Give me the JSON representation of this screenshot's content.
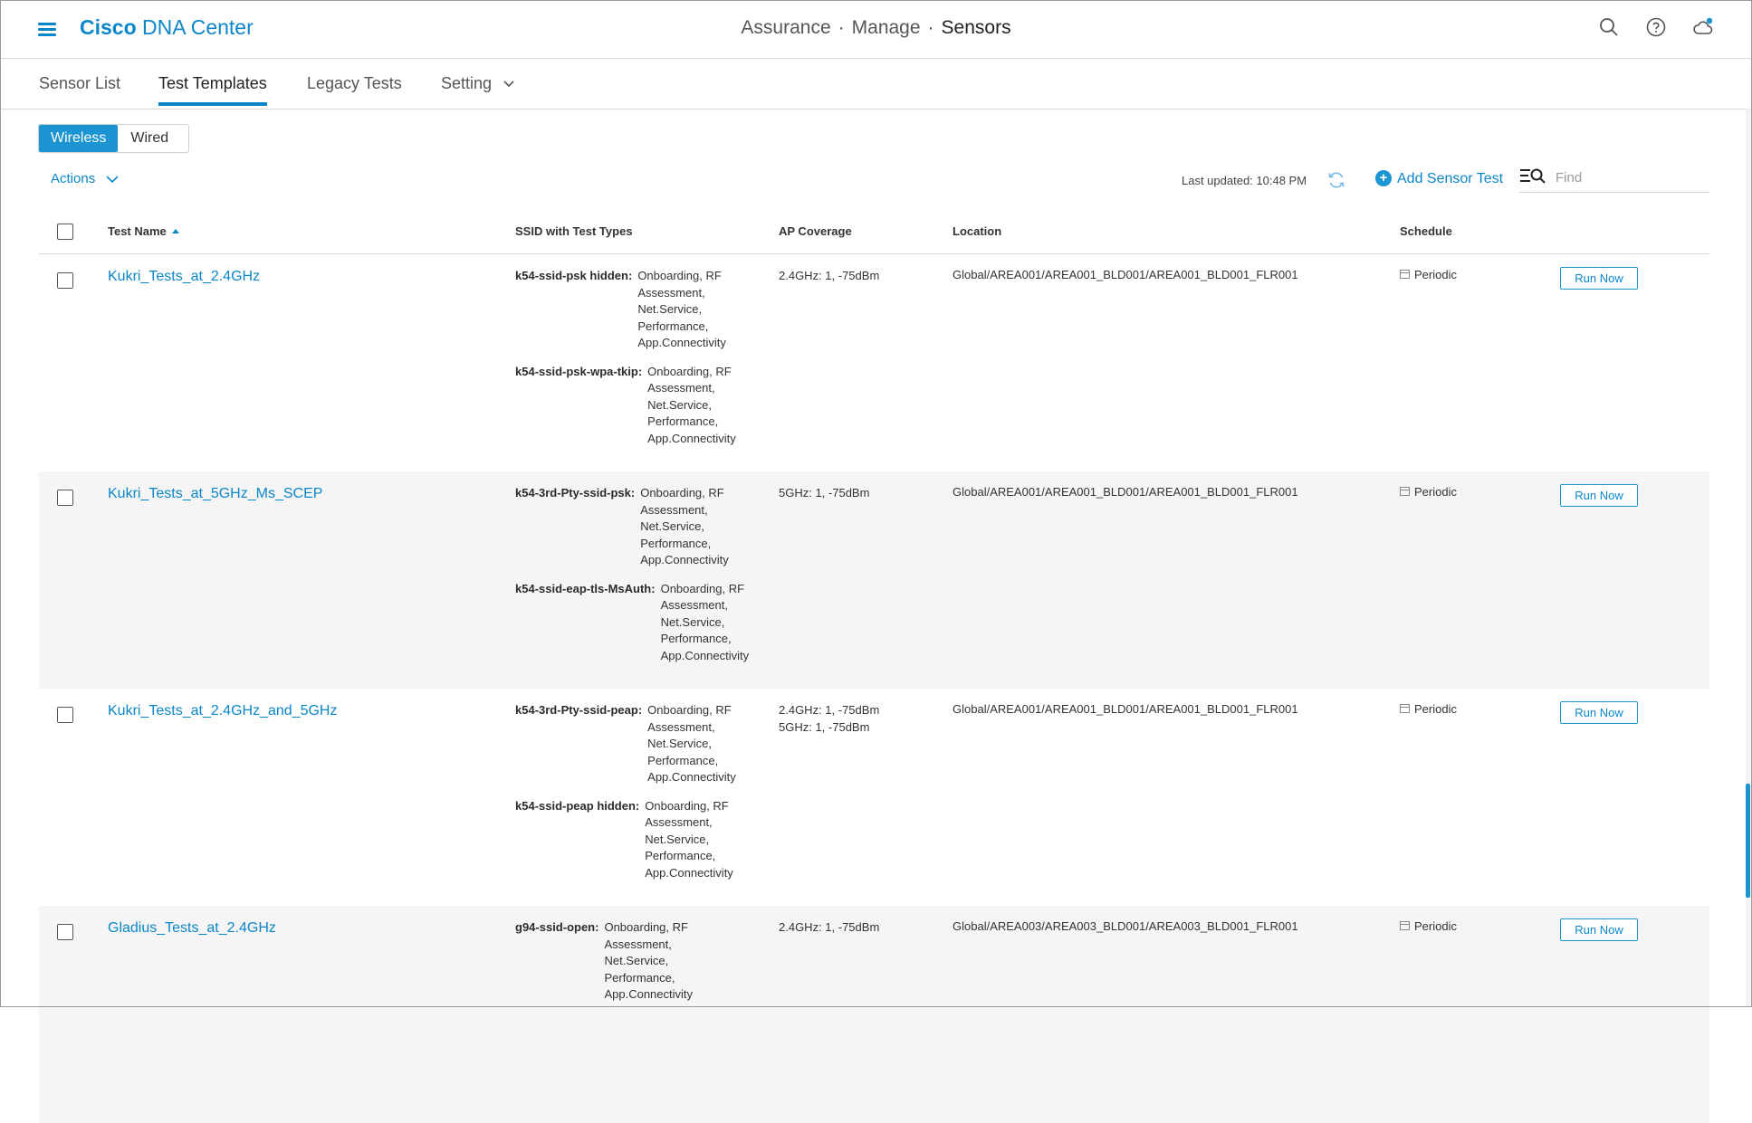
{
  "header": {
    "brand_bold": "Cisco",
    "brand_rest": "DNA Center",
    "breadcrumb": [
      "Assurance",
      "Manage",
      "Sensors"
    ],
    "breadcrumb_sep": "·",
    "icons": [
      "menu-icon",
      "search-icon",
      "help-icon",
      "cloud-notification-icon"
    ]
  },
  "tabs": [
    {
      "label": "Sensor List"
    },
    {
      "label": "Test Templates",
      "active": true
    },
    {
      "label": "Legacy Tests"
    },
    {
      "label": "Setting",
      "has_dropdown": true
    }
  ],
  "toggle": {
    "options": [
      "Wireless",
      "Wired"
    ],
    "selected": "Wireless"
  },
  "toolbar": {
    "actions_label": "Actions",
    "last_updated": "Last updated: 10:48 PM",
    "add_label": "Add Sensor Test",
    "find_placeholder": "Find"
  },
  "table": {
    "columns": [
      "Test Name",
      "SSID with Test Types",
      "AP Coverage",
      "Location",
      "Schedule"
    ],
    "sort_column": "Test Name",
    "rows": [
      {
        "name": "Kukri_Tests_at_2.4GHz",
        "ssids": [
          {
            "ssid": "k54-ssid-psk hidden:",
            "types": "Onboarding, RF Assessment, Net.Service, Performance, App.Connectivity"
          },
          {
            "ssid": "k54-ssid-psk-wpa-tkip:",
            "types": "Onboarding, RF Assessment, Net.Service, Performance, App.Connectivity"
          }
        ],
        "ap_coverage": [
          "2.4GHz: 1, -75dBm"
        ],
        "location": "Global/AREA001/AREA001_BLD001/AREA001_BLD001_FLR001",
        "schedule": "Periodic",
        "action": "Run Now"
      },
      {
        "name": "Kukri_Tests_at_5GHz_Ms_SCEP",
        "ssids": [
          {
            "ssid": "k54-3rd-Pty-ssid-psk:",
            "types": "Onboarding, RF Assessment, Net.Service, Performance, App.Connectivity"
          },
          {
            "ssid": "k54-ssid-eap-tls-MsAuth:",
            "types": "Onboarding, RF Assessment, Net.Service, Performance, App.Connectivity"
          }
        ],
        "ap_coverage": [
          "5GHz: 1, -75dBm"
        ],
        "location": "Global/AREA001/AREA001_BLD001/AREA001_BLD001_FLR001",
        "schedule": "Periodic",
        "action": "Run Now"
      },
      {
        "name": "Kukri_Tests_at_2.4GHz_and_5GHz",
        "ssids": [
          {
            "ssid": "k54-3rd-Pty-ssid-peap:",
            "types": "Onboarding, RF Assessment, Net.Service, Performance, App.Connectivity"
          },
          {
            "ssid": "k54-ssid-peap hidden:",
            "types": "Onboarding, RF Assessment, Net.Service, Performance, App.Connectivity"
          }
        ],
        "ap_coverage": [
          "2.4GHz: 1, -75dBm",
          "5GHz: 1, -75dBm"
        ],
        "location": "Global/AREA001/AREA001_BLD001/AREA001_BLD001_FLR001",
        "schedule": "Periodic",
        "action": "Run Now"
      },
      {
        "name": "Gladius_Tests_at_2.4GHz",
        "ssids": [
          {
            "ssid": "g94-ssid-open:",
            "types": "Onboarding, RF Assessment, Net.Service, Performance, App.Connectivity"
          }
        ],
        "ap_coverage": [
          "2.4GHz: 1, -75dBm"
        ],
        "location": "Global/AREA003/AREA003_BLD001/AREA003_BLD001_FLR001",
        "schedule": "Periodic",
        "action": "Run Now"
      }
    ]
  },
  "colors": {
    "accent": "#0b86c9",
    "accent_fill": "#1b94d1",
    "row_alt": "#f5f5f5"
  }
}
